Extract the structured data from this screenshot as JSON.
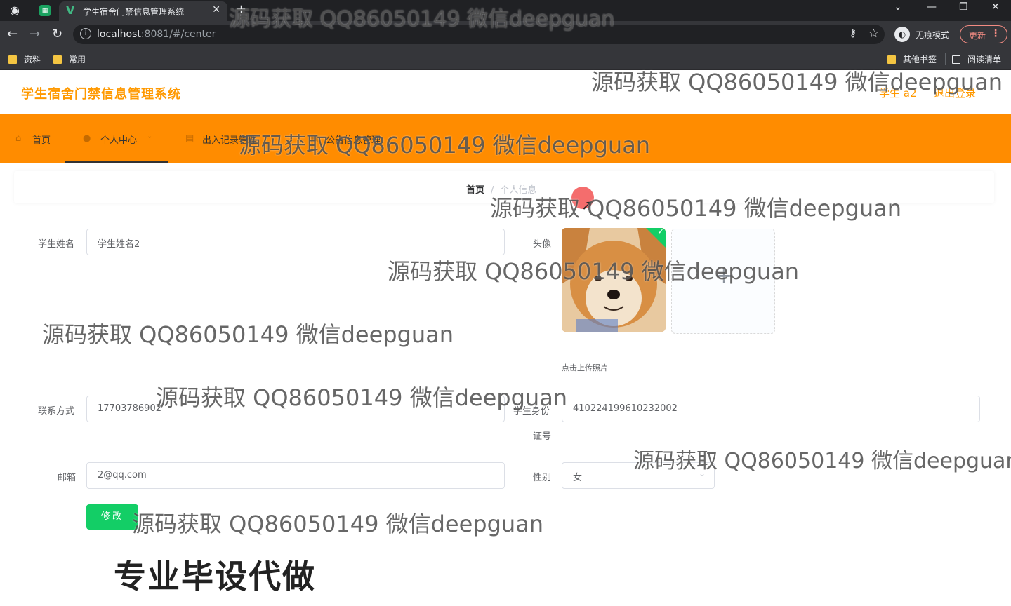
{
  "browser": {
    "tab_title": "学生宿舍门禁信息管理系统",
    "url_host": "localhost",
    "url_rest": ":8081/#/center",
    "incognito_label": "无痕模式",
    "update_label": "更新",
    "bookmarks": [
      "资料",
      "常用"
    ],
    "bookmarks_right": [
      "其他书签",
      "阅读清单"
    ]
  },
  "header": {
    "app_title": "学生宿舍门禁信息管理系统",
    "user": "学生 a2",
    "logout": "退出登录"
  },
  "nav": {
    "items": [
      "首页",
      "个人中心",
      "出入记录管理",
      "公告信息管理"
    ]
  },
  "breadcrumb": {
    "home": "首页",
    "separator": "/",
    "current": "个人信息"
  },
  "form": {
    "name_label": "学生姓名",
    "name_value": "学生姓名2",
    "avatar_label": "头像",
    "upload_tip": "点击上传照片",
    "upload_plus": "+",
    "phone_label": "联系方式",
    "phone_value": "17703786902",
    "id_label_1": "学生身份",
    "id_label_2": "证号",
    "id_value": "410224199610232002",
    "email_label": "邮箱",
    "email_value": "2@qq.com",
    "gender_label": "性别",
    "gender_value": "女",
    "submit": "修改"
  },
  "overlay": {
    "watermark": "源码获取 QQ86050149 微信deepguan",
    "promo": "专业毕设代做"
  },
  "colors": {
    "brand": "#ff9900",
    "nav_bg": "#ff8c00",
    "success": "#13ce66"
  }
}
